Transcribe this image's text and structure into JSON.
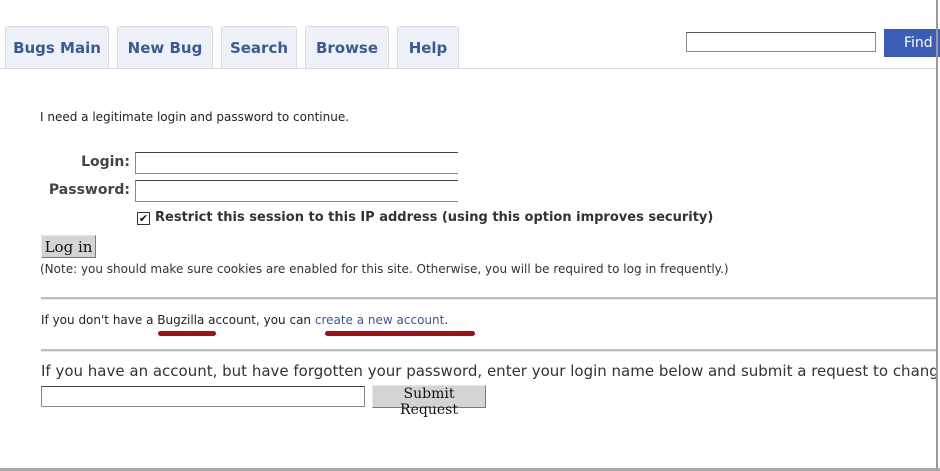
{
  "tabs": [
    "Bugs Main",
    "New Bug",
    "Search",
    "Browse",
    "Help"
  ],
  "header": {
    "find_label": "Find",
    "find_value": ""
  },
  "login": {
    "intro": "I need a legitimate login and password to continue.",
    "login_label": "Login:",
    "password_label": "Password:",
    "login_value": "",
    "password_value": "",
    "restrict_checked": true,
    "restrict_label": "Restrict this session to this IP address (using this option improves security)",
    "login_button": "Log in",
    "note": "(Note: you should make sure cookies are enabled for this site. Otherwise, you will be required to log in frequently.)"
  },
  "account": {
    "prefix": "If you don't have a ",
    "bugzilla": "Bugzilla",
    "middle": " account, you can ",
    "link": "create a new account",
    "suffix": "."
  },
  "forgot": {
    "text": "If you have an account, but have forgotten your password, enter your login name below and submit a request to change your password.",
    "value": "",
    "submit_label": "Submit Request"
  },
  "colors": {
    "tab_text": "#3b5998",
    "find_button": "#3b5db5",
    "annotation": "#a30f12"
  }
}
